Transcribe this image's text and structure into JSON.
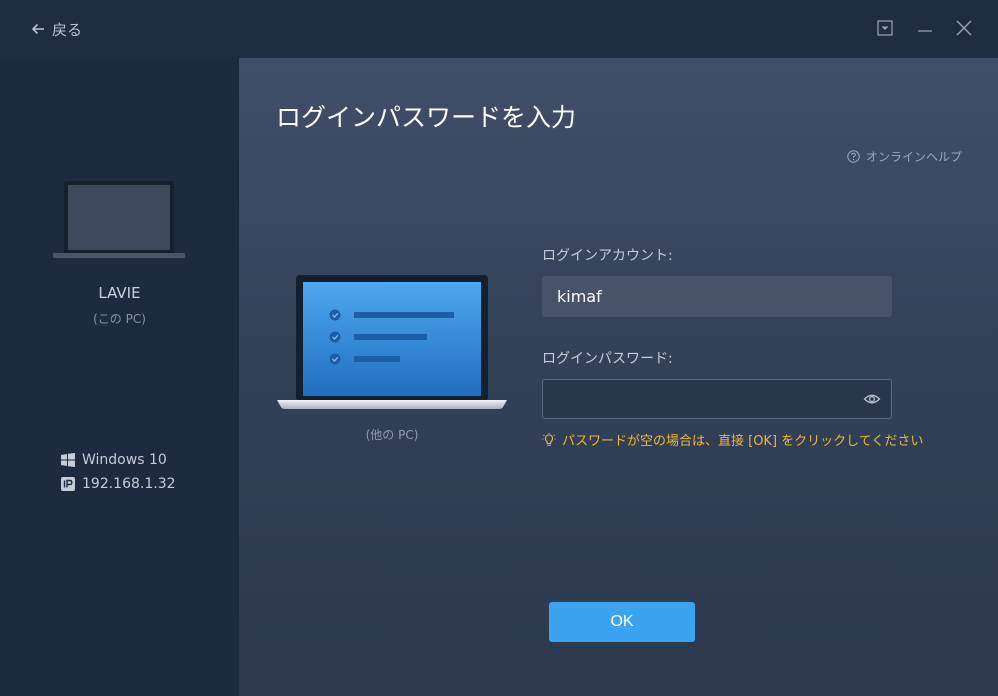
{
  "titlebar": {
    "back_label": "戻る",
    "icons": [
      "arrow-left-icon",
      "dropdown-box-icon",
      "minimize-icon",
      "close-icon"
    ]
  },
  "sidebar": {
    "device_name": "LAVIE",
    "device_sub": "(この PC)",
    "os": "Windows 10",
    "ip": "192.168.1.32"
  },
  "main": {
    "title": "ログインパスワードを入力",
    "help_label": "オンラインヘルプ",
    "other_pc_label": "(他の PC)",
    "account_label": "ログインアカウント:",
    "account_value": "kimaf",
    "password_label": "ログインパスワード:",
    "password_value": "",
    "hint": "パスワードが空の場合は、直接 [OK] をクリックしてください",
    "ok_label": "OK"
  },
  "colors": {
    "accent": "#3aa3f2",
    "warning": "#f2b43a",
    "sidebar_bg": "#1d2b40",
    "main_bg": "#3a4860"
  }
}
